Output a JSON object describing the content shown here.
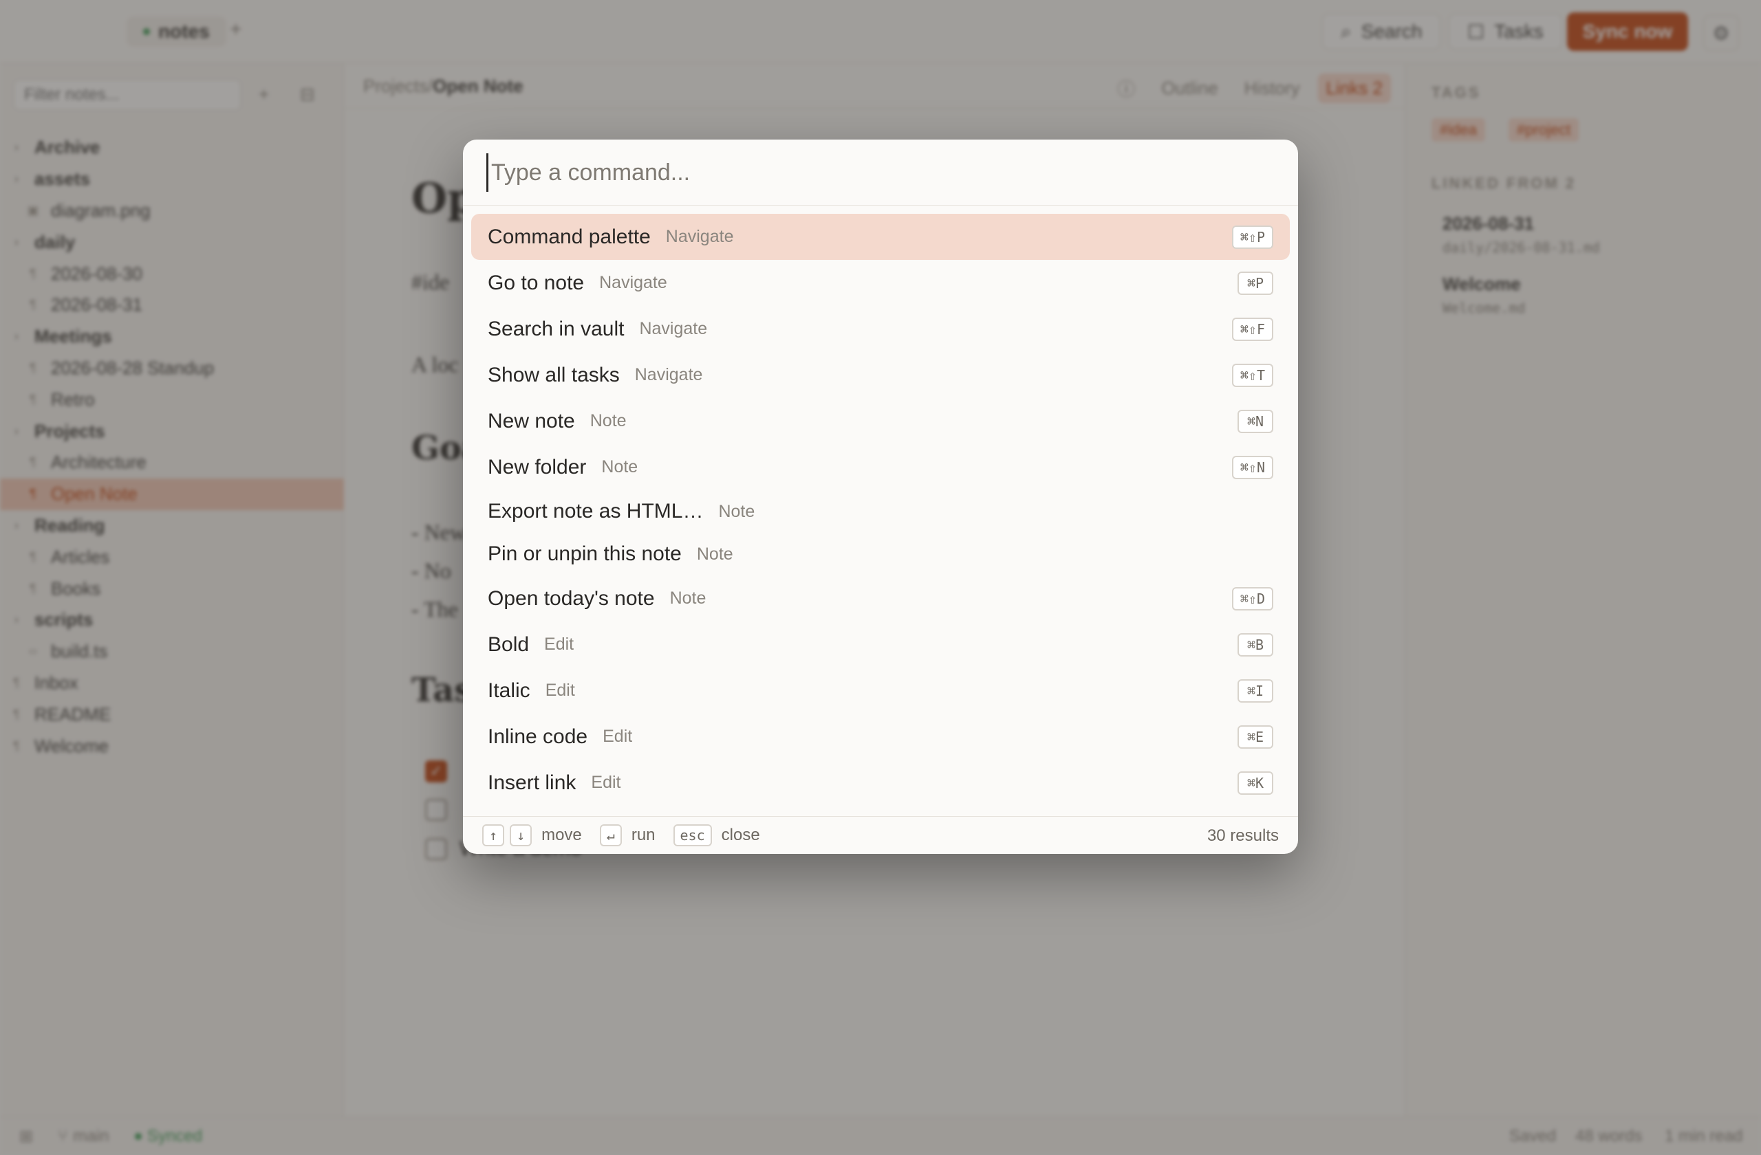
{
  "topbar": {
    "vault_name": "notes",
    "add_tab": "+",
    "search_label": "Search",
    "tasks_label": "Tasks",
    "sync_label": "Sync now"
  },
  "sidebar": {
    "filter_placeholder": "Filter notes...",
    "tree": [
      {
        "label": "Archive",
        "kind": "folder",
        "depth": 0,
        "glyph": "›"
      },
      {
        "label": "assets",
        "kind": "folder",
        "depth": 0,
        "glyph": "›"
      },
      {
        "label": "diagram.png",
        "kind": "image",
        "depth": 1,
        "glyph": "▣"
      },
      {
        "label": "daily",
        "kind": "folder",
        "depth": 0,
        "glyph": "›"
      },
      {
        "label": "2026-08-30",
        "kind": "note",
        "depth": 1,
        "glyph": "¶"
      },
      {
        "label": "2026-08-31",
        "kind": "note",
        "depth": 1,
        "glyph": "¶"
      },
      {
        "label": "Meetings",
        "kind": "folder",
        "depth": 0,
        "glyph": "›"
      },
      {
        "label": "2026-08-28 Standup",
        "kind": "note",
        "depth": 1,
        "glyph": "¶"
      },
      {
        "label": "Retro",
        "kind": "note",
        "depth": 1,
        "glyph": "¶"
      },
      {
        "label": "Projects",
        "kind": "folder",
        "depth": 0,
        "glyph": "›"
      },
      {
        "label": "Architecture",
        "kind": "note",
        "depth": 1,
        "glyph": "¶"
      },
      {
        "label": "Open Note",
        "kind": "note",
        "depth": 1,
        "glyph": "¶",
        "active": true
      },
      {
        "label": "Reading",
        "kind": "folder",
        "depth": 0,
        "glyph": "›"
      },
      {
        "label": "Articles",
        "kind": "note",
        "depth": 1,
        "glyph": "¶"
      },
      {
        "label": "Books",
        "kind": "note",
        "depth": 1,
        "glyph": "¶"
      },
      {
        "label": "scripts",
        "kind": "folder",
        "depth": 0,
        "glyph": "›"
      },
      {
        "label": "build.ts",
        "kind": "code",
        "depth": 1,
        "glyph": "‹›"
      },
      {
        "label": "Inbox",
        "kind": "note",
        "depth": 0,
        "glyph": "¶"
      },
      {
        "label": "README",
        "kind": "note",
        "depth": 0,
        "glyph": "¶"
      },
      {
        "label": "Welcome",
        "kind": "note",
        "depth": 0,
        "glyph": "¶"
      }
    ]
  },
  "editor": {
    "breadcrumb_parent": "Projects/",
    "breadcrumb_current": "Open Note",
    "tabs": {
      "outline": "Outline",
      "history": "History",
      "links": "Links 2"
    },
    "title_partial": "Op",
    "tag_line_partial": "#ide",
    "para_partial": "A loc",
    "h2_goals_partial": "Goa",
    "bullets_partial": [
      "- New",
      "- No",
      "- The"
    ],
    "h2_tasks_partial": "Tas",
    "tasks": [
      {
        "checked": true,
        "text": ""
      },
      {
        "checked": false,
        "text": ""
      },
      {
        "checked": false,
        "text": "Write a demo"
      }
    ]
  },
  "right_panel": {
    "tags_label": "TAGS",
    "tags": [
      "#idea",
      "#project"
    ],
    "linked_label": "LINKED FROM 2",
    "links": [
      {
        "title": "2026-08-31",
        "path": "daily/2026-08-31.md"
      },
      {
        "title": "Welcome",
        "path": "Welcome.md"
      }
    ]
  },
  "statusbar": {
    "branch": "main",
    "sync_state": "Synced",
    "saved": "Saved",
    "words": "48 words",
    "read_time": "1 min read"
  },
  "palette": {
    "placeholder": "Type a command...",
    "commands": [
      {
        "label": "Command palette",
        "category": "Navigate",
        "shortcut": "⌘⇧P",
        "selected": true
      },
      {
        "label": "Go to note",
        "category": "Navigate",
        "shortcut": "⌘P"
      },
      {
        "label": "Search in vault",
        "category": "Navigate",
        "shortcut": "⌘⇧F"
      },
      {
        "label": "Show all tasks",
        "category": "Navigate",
        "shortcut": "⌘⇧T"
      },
      {
        "label": "New note",
        "category": "Note",
        "shortcut": "⌘N"
      },
      {
        "label": "New folder",
        "category": "Note",
        "shortcut": "⌘⇧N"
      },
      {
        "label": "Export note as HTML…",
        "category": "Note",
        "shortcut": ""
      },
      {
        "label": "Pin or unpin this note",
        "category": "Note",
        "shortcut": ""
      },
      {
        "label": "Open today's note",
        "category": "Note",
        "shortcut": "⌘⇧D"
      },
      {
        "label": "Bold",
        "category": "Edit",
        "shortcut": "⌘B"
      },
      {
        "label": "Italic",
        "category": "Edit",
        "shortcut": "⌘I"
      },
      {
        "label": "Inline code",
        "category": "Edit",
        "shortcut": "⌘E"
      },
      {
        "label": "Insert link",
        "category": "Edit",
        "shortcut": "⌘K"
      }
    ],
    "footer": {
      "up_key": "↑",
      "down_key": "↓",
      "move_label": "move",
      "enter_key": "↵",
      "run_label": "run",
      "esc_key": "esc",
      "close_label": "close",
      "results": "30 results"
    }
  },
  "colors": {
    "accent": "#c2410c",
    "selection": "#f4d9cd",
    "synced": "#3d9b56"
  }
}
